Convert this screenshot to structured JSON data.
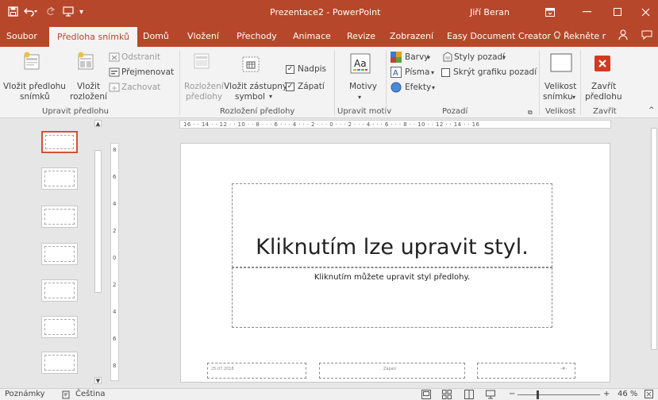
{
  "window": {
    "title": "Prezentace2 - PowerPoint",
    "user": "Jiří Beran"
  },
  "tabs": [
    {
      "label": "Soubor"
    },
    {
      "label": "Předloha snímků"
    },
    {
      "label": "Domů"
    },
    {
      "label": "Vložení"
    },
    {
      "label": "Přechody"
    },
    {
      "label": "Animace"
    },
    {
      "label": "Revize"
    },
    {
      "label": "Zobrazení"
    },
    {
      "label": "Easy Document Creator"
    },
    {
      "label": "Řekněte r"
    }
  ],
  "ribbon": {
    "upravit_predlohu": {
      "vlozit_predlohu_1": "Vložit předlohu",
      "vlozit_predlohu_2": "snímků",
      "vlozit_rozlozeni_1": "Vložit",
      "vlozit_rozlozeni_2": "rozložení",
      "odstranit": "Odstranit",
      "prejmenovat": "Přejmenovat",
      "zachovat": "Zachovat",
      "group": "Upravit předlohu"
    },
    "rozlozeni_predlohy": {
      "rozlozeni_1": "Rozložení",
      "rozlozeni_2": "předlohy",
      "vlozit_zastupny_1": "Vložit zástupný",
      "vlozit_zastupny_2": "symbol",
      "nadpis": "Nadpis",
      "zapati": "Zápatí",
      "group": "Rozložení předlohy"
    },
    "upravit_motiv": {
      "motivy": "Motivy",
      "group": "Upravit motiv"
    },
    "pozadi": {
      "barvy": "Barvy",
      "pisma": "Písma",
      "efekty": "Efekty",
      "styly_pozadi": "Styly pozadí",
      "skryt_grafiku": "Skrýt grafiku pozadí",
      "group": "Pozadí"
    },
    "velikost": {
      "velikost_1": "Velikost",
      "velikost_2": "snímku",
      "group": "Velikost"
    },
    "zavrit": {
      "zavrit_1": "Zavřít",
      "zavrit_2": "předlohu",
      "group": "Zavřít"
    }
  },
  "ruler": {
    "horizontal": "16 · · 14 · · 12 · · 10 · · 8 · · · 6 · · · 4 · · · 2 · · · 0 · · · 2 · · · 4 · · · 6 · · · 8 · · 10 · · 12 · · 14 · · 16",
    "vertical": [
      "8",
      "6",
      "4",
      "2",
      "0",
      "2",
      "4",
      "6",
      "8"
    ]
  },
  "slide": {
    "title": "Kliknutím lze upravit styl.",
    "body": "Kliknutím můžete upravit styl předlohy.",
    "date": "25.07.2018",
    "footer": "Zápatí",
    "number": "‹#›"
  },
  "statusbar": {
    "notes": "Poznámky",
    "language": "Čeština",
    "zoom": "46 %"
  },
  "colors": {
    "accent": "#b7472a",
    "selected_thumb": "#d35230"
  }
}
